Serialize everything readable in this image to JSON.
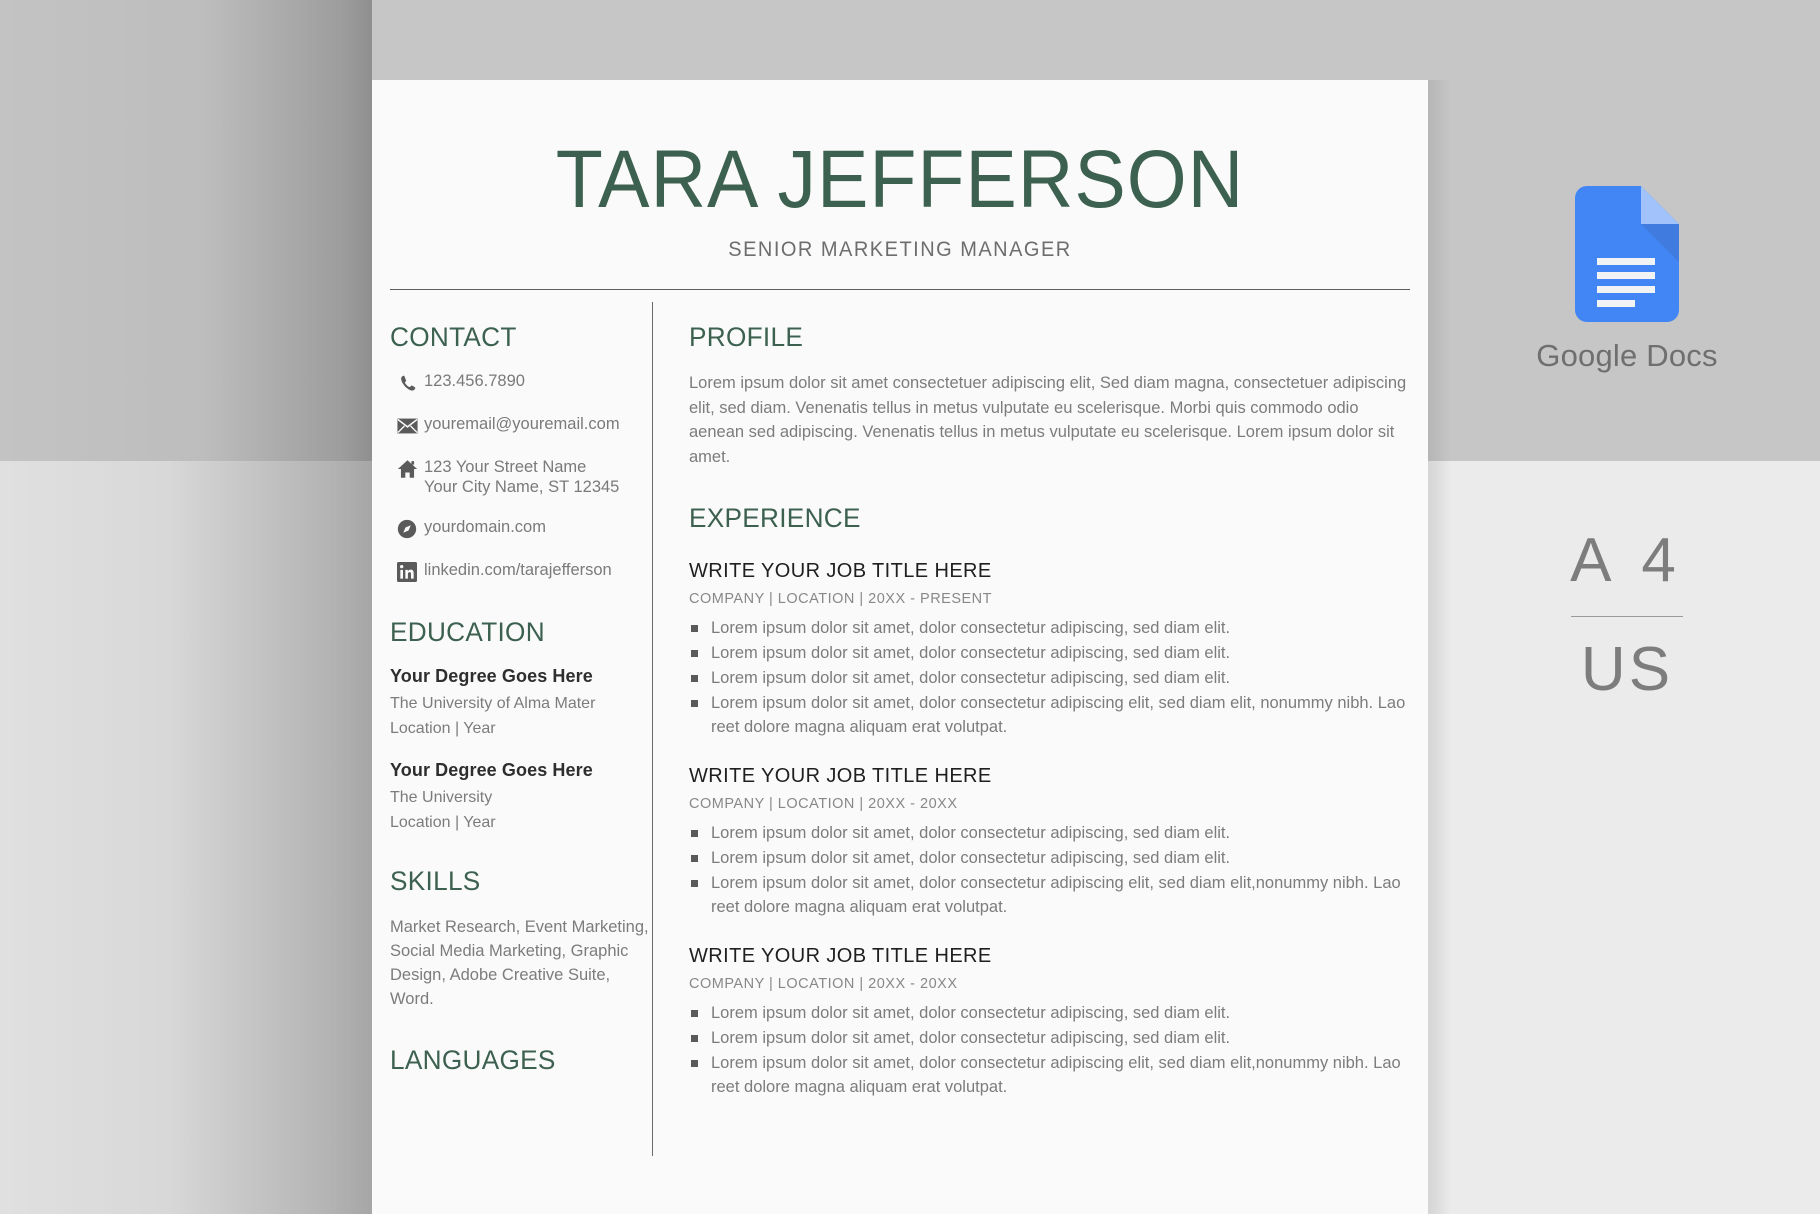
{
  "resume": {
    "name": "TARA JEFFERSON",
    "job_subtitle": "SENIOR MARKETING MANAGER",
    "contact": {
      "heading": "CONTACT",
      "items": [
        {
          "icon": "phone-icon",
          "text": "123.456.7890"
        },
        {
          "icon": "envelope-icon",
          "text": "youremail@youremail.com"
        },
        {
          "icon": "home-icon",
          "line1": "123 Your Street Name",
          "line2": "Your City Name, ST 12345"
        },
        {
          "icon": "compass-icon",
          "text": "yourdomain.com"
        },
        {
          "icon": "linkedin-icon",
          "text": "linkedin.com/tarajefferson"
        }
      ]
    },
    "education": {
      "heading": "EDUCATION",
      "items": [
        {
          "degree": "Your Degree Goes Here",
          "school": "The University of Alma Mater",
          "meta": "Location  |  Year"
        },
        {
          "degree": "Your Degree Goes Here",
          "school": "The University",
          "meta": "Location  |  Year"
        }
      ]
    },
    "skills": {
      "heading": "SKILLS",
      "text": "Market Research, Event Marketing, Social Media Marketing, Graphic Design, Adobe Creative Suite, Word."
    },
    "languages": {
      "heading": "LANGUAGES"
    },
    "profile": {
      "heading": "PROFILE",
      "text": "Lorem ipsum dolor sit amet consectetuer adipiscing elit, Sed diam magna, consectetuer adipiscing elit, sed diam. Venenatis tellus in metus vulputate eu scelerisque. Morbi quis commodo odio aenean sed adipiscing. Venenatis tellus in metus vulputate eu scelerisque. Lorem ipsum dolor sit amet."
    },
    "experience": {
      "heading": "EXPERIENCE",
      "entries": [
        {
          "title": "WRITE YOUR JOB TITLE HERE",
          "meta": "COMPANY  |  LOCATION  |  20XX - PRESENT",
          "bullets": [
            "Lorem ipsum dolor sit amet, dolor consectetur adipiscing, sed diam elit.",
            "Lorem ipsum dolor sit amet, dolor consectetur adipiscing, sed diam elit.",
            "Lorem ipsum dolor sit amet, dolor consectetur adipiscing, sed diam elit.",
            "Lorem ipsum dolor sit amet, dolor consectetur adipiscing elit, sed diam elit, nonummy nibh. Lao reet dolore magna aliquam erat volutpat."
          ]
        },
        {
          "title": "WRITE YOUR JOB TITLE HERE",
          "meta": "COMPANY  |  LOCATION  |  20XX - 20XX",
          "bullets": [
            "Lorem ipsum dolor sit amet, dolor consectetur adipiscing, sed diam elit.",
            "Lorem ipsum dolor sit amet, dolor consectetur adipiscing, sed diam elit.",
            "Lorem ipsum dolor sit amet, dolor consectetur adipiscing elit, sed diam elit,nonummy nibh. Lao reet dolore magna aliquam erat volutpat."
          ]
        },
        {
          "title": "WRITE YOUR JOB TITLE HERE",
          "meta": "COMPANY  |  LOCATION  |  20XX - 20XX",
          "bullets": [
            "Lorem ipsum dolor sit amet, dolor consectetur adipiscing, sed diam elit.",
            "Lorem ipsum dolor sit amet, dolor consectetur adipiscing, sed diam elit.",
            "Lorem ipsum dolor sit amet, dolor consectetur adipiscing elit, sed diam elit,nonummy nibh. Lao reet dolore magna aliquam erat volutpat."
          ]
        }
      ]
    }
  },
  "branding": {
    "app_icon": "google-docs-icon",
    "app_label": "Google Docs",
    "paper_size_primary": "A 4",
    "paper_size_secondary": "US"
  },
  "colors": {
    "accent_green": "#3d6150",
    "body_grey": "#7c7c7c",
    "docs_blue": "#4285F4",
    "page_bg": "#fafafa"
  }
}
